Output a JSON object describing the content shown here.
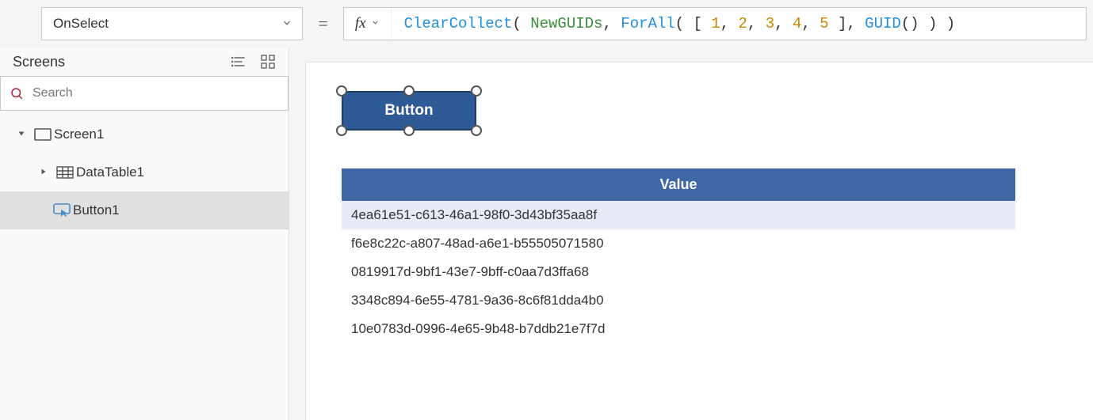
{
  "property_selector": {
    "value": "OnSelect"
  },
  "formula": {
    "tokens": [
      {
        "t": "ClearCollect",
        "c": "tok-fn"
      },
      {
        "t": "( ",
        "c": "tok-punc"
      },
      {
        "t": "NewGUIDs",
        "c": "tok-id"
      },
      {
        "t": ", ",
        "c": "tok-punc"
      },
      {
        "t": "ForAll",
        "c": "tok-fn"
      },
      {
        "t": "( [ ",
        "c": "tok-punc"
      },
      {
        "t": "1",
        "c": "tok-num"
      },
      {
        "t": ", ",
        "c": "tok-punc"
      },
      {
        "t": "2",
        "c": "tok-num"
      },
      {
        "t": ", ",
        "c": "tok-punc"
      },
      {
        "t": "3",
        "c": "tok-num"
      },
      {
        "t": ", ",
        "c": "tok-punc"
      },
      {
        "t": "4",
        "c": "tok-num"
      },
      {
        "t": ", ",
        "c": "tok-punc"
      },
      {
        "t": "5",
        "c": "tok-num"
      },
      {
        "t": " ], ",
        "c": "tok-punc"
      },
      {
        "t": "GUID",
        "c": "tok-fn"
      },
      {
        "t": "() ) )",
        "c": "tok-punc"
      }
    ]
  },
  "left_panel": {
    "title": "Screens",
    "search_placeholder": "Search",
    "tree": {
      "screen1": "Screen1",
      "datatable1": "DataTable1",
      "button1": "Button1"
    }
  },
  "canvas": {
    "button_label": "Button",
    "table": {
      "header": "Value",
      "rows": [
        "4ea61e51-c613-46a1-98f0-3d43bf35aa8f",
        "f6e8c22c-a807-48ad-a6e1-b55505071580",
        "0819917d-9bf1-43e7-9bff-c0aa7d3ffa68",
        "3348c894-6e55-4781-9a36-8c6f81dda4b0",
        "10e0783d-0996-4e65-9b48-b7ddb21e7f7d"
      ]
    }
  }
}
